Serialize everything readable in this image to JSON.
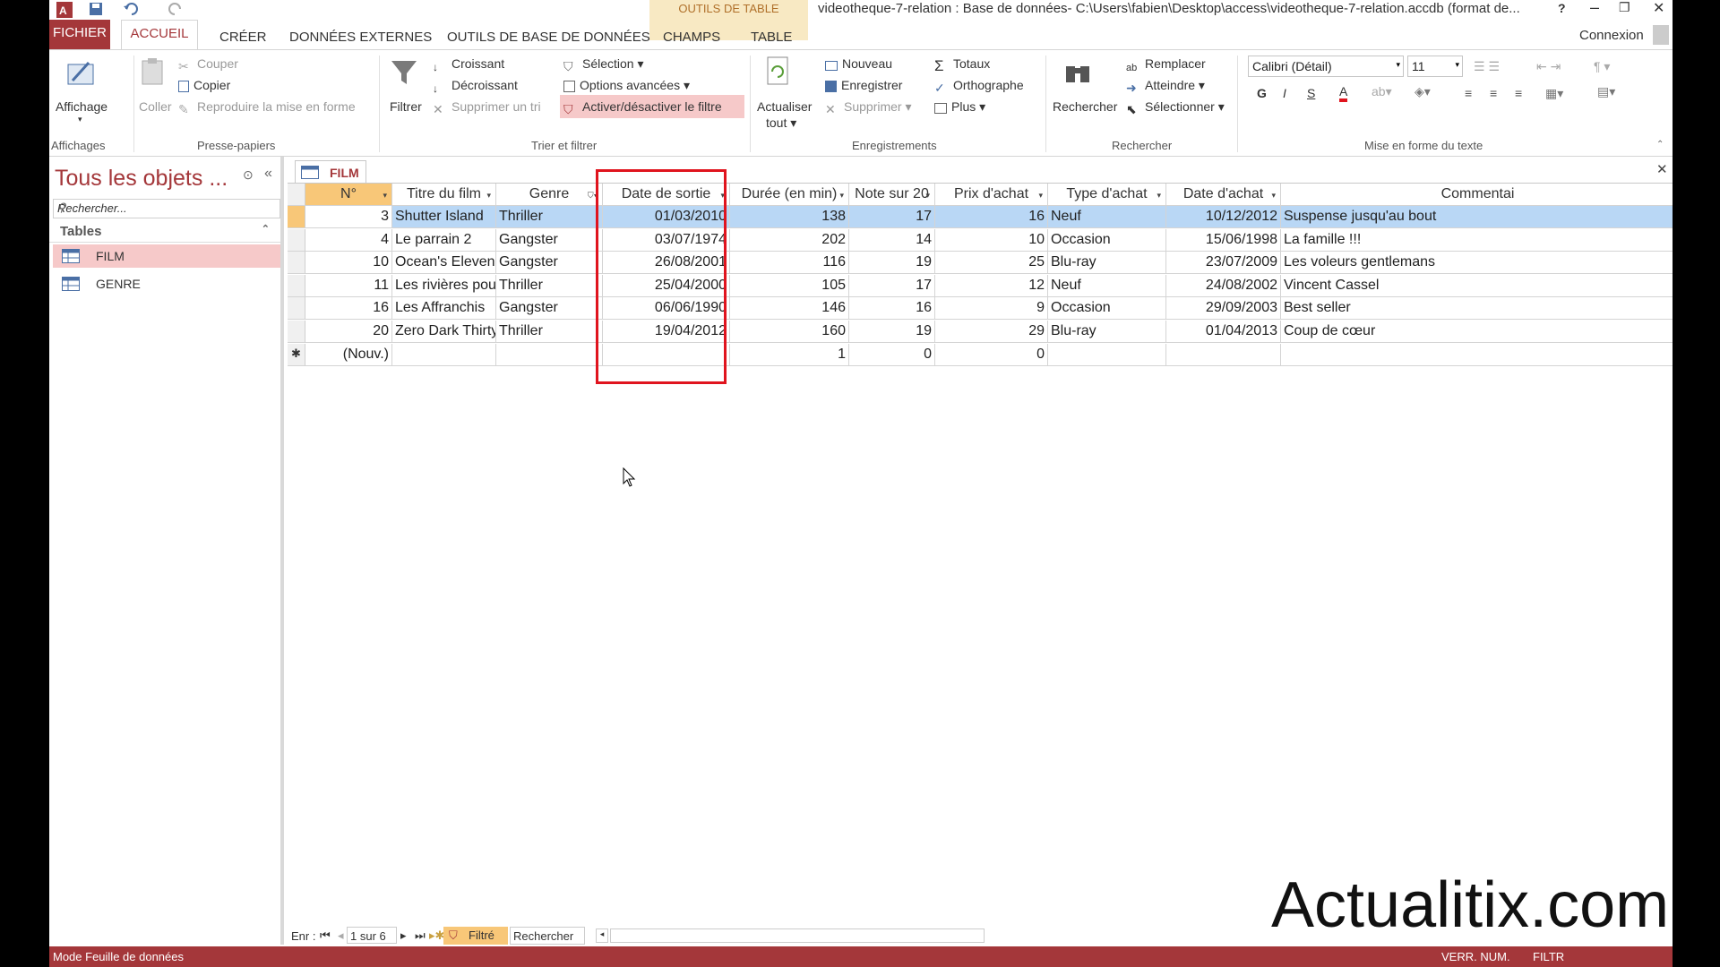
{
  "titlebar": {
    "context_group": "OUTILS DE TABLE",
    "title": "videotheque-7-relation : Base de données- C:\\Users\\fabien\\Desktop\\access\\videotheque-7-relation.accdb (format de...",
    "help": "?",
    "connexion": "Connexion"
  },
  "tabs": {
    "fichier": "FICHIER",
    "accueil": "ACCUEIL",
    "creer": "CRÉER",
    "donnees_externes": "DONNÉES EXTERNES",
    "outils_bdd": "OUTILS DE BASE DE DONNÉES",
    "champs": "CHAMPS",
    "table": "TABLE"
  },
  "ribbon": {
    "affichage": "Affichage",
    "group_affichages": "Affichages",
    "coller": "Coller",
    "couper": "Couper",
    "copier": "Copier",
    "reproduire": "Reproduire la mise en forme",
    "group_presse": "Presse-papiers",
    "filtrer": "Filtrer",
    "croissant": "Croissant",
    "decroissant": "Décroissant",
    "supprimer_tri": "Supprimer un tri",
    "selection": "Sélection",
    "options_avancees": "Options avancées",
    "activer_filtre": "Activer/désactiver le filtre",
    "group_trier": "Trier et filtrer",
    "actualiser": "Actualiser",
    "tout": "tout",
    "nouveau": "Nouveau",
    "enregistrer": "Enregistrer",
    "supprimer": "Supprimer",
    "totaux": "Totaux",
    "orthographe": "Orthographe",
    "plus": "Plus",
    "group_enreg": "Enregistrements",
    "rechercher": "Rechercher",
    "remplacer": "Remplacer",
    "atteindre": "Atteindre",
    "selectionner": "Sélectionner",
    "group_rechercher": "Rechercher",
    "font_name": "Calibri (Détail)",
    "font_size": "11",
    "bold": "G",
    "italic": "I",
    "underline": "S",
    "group_mise_en_forme": "Mise en forme du texte"
  },
  "nav": {
    "title": "Tous les objets ...",
    "search_placeholder": "Rechercher...",
    "section": "Tables",
    "items": [
      "FILM",
      "GENRE"
    ]
  },
  "doc": {
    "tab": "FILM"
  },
  "table": {
    "columns": [
      "N°",
      "Titre du film",
      "Genre",
      "Date de sortie",
      "Durée (en min)",
      "Note sur 20",
      "Prix d'achat",
      "Type d'achat",
      "Date d'achat",
      "Commentai"
    ],
    "rows": [
      [
        "3",
        "Shutter Island",
        "Thriller",
        "01/03/2010",
        "138",
        "17",
        "16",
        "Neuf",
        "10/12/2012",
        "Suspense jusqu'au bout"
      ],
      [
        "4",
        "Le parrain 2",
        "Gangster",
        "03/07/1974",
        "202",
        "14",
        "10",
        "Occasion",
        "15/06/1998",
        "La famille !!!"
      ],
      [
        "10",
        "Ocean's Eleven",
        "Gangster",
        "26/08/2001",
        "116",
        "19",
        "25",
        "Blu-ray",
        "23/07/2009",
        "Les voleurs gentlemans"
      ],
      [
        "11",
        "Les rivières pourp",
        "Thriller",
        "25/04/2000",
        "105",
        "17",
        "12",
        "Neuf",
        "24/08/2002",
        "Vincent Cassel"
      ],
      [
        "16",
        "Les Affranchis",
        "Gangster",
        "06/06/1990",
        "146",
        "16",
        "9",
        "Occasion",
        "29/09/2003",
        "Best seller"
      ],
      [
        "20",
        "Zero Dark Thirty",
        "Thriller",
        "19/04/2012",
        "160",
        "19",
        "29",
        "Blu-ray",
        "01/04/2013",
        "Coup de cœur"
      ]
    ],
    "new_row": [
      "(Nouv.)",
      "",
      "",
      "",
      "1",
      "0",
      "0",
      "",
      "",
      ""
    ],
    "new_marker": "✱"
  },
  "recnav": {
    "label": "Enr :",
    "position": "1 sur 6",
    "filtered": "Filtré",
    "search": "Rechercher"
  },
  "status": {
    "mode": "Mode Feuille de données",
    "verr_num": "VERR. NUM.",
    "filtre": "FILTR"
  },
  "watermark": "Actualitix.com",
  "colors": {
    "accent": "#a4373a",
    "highlight": "#e0141e",
    "selected_row": "#b9d7f5"
  }
}
